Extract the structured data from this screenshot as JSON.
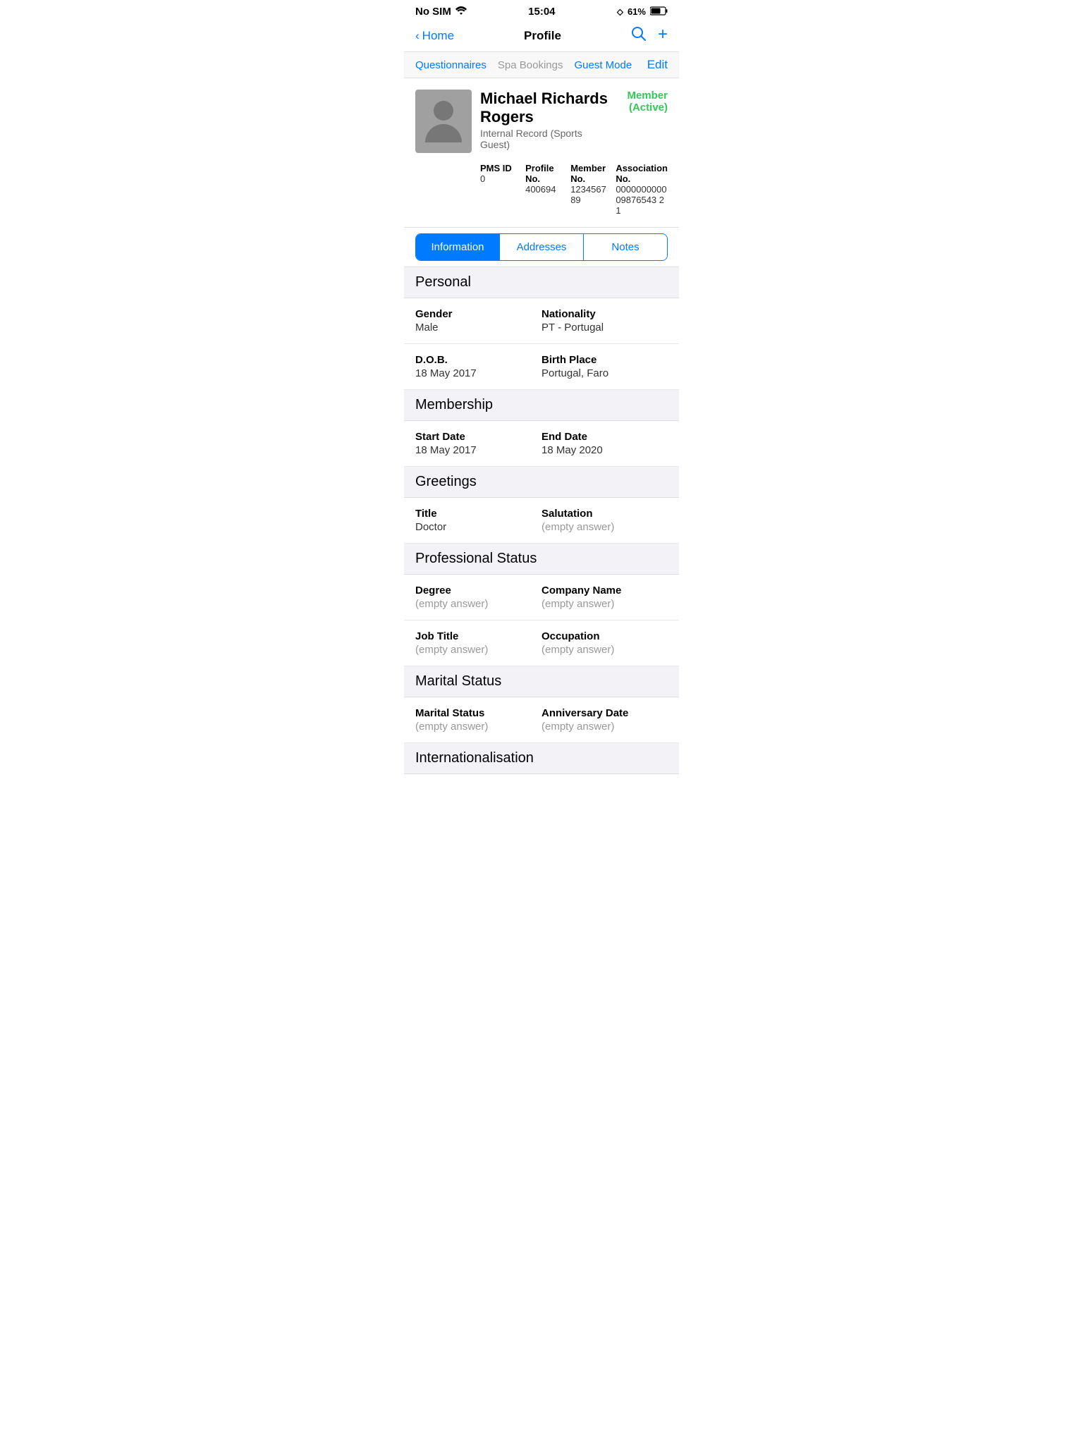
{
  "statusBar": {
    "carrier": "No SIM",
    "time": "15:04",
    "bluetooth": "B",
    "battery": "61%"
  },
  "navBar": {
    "backLabel": "Home",
    "title": "Profile",
    "searchIcon": "🔍",
    "addIcon": "+"
  },
  "subNav": {
    "items": [
      {
        "label": "Questionnaires",
        "active": true
      },
      {
        "label": "Spa Bookings",
        "active": false
      },
      {
        "label": "Guest Mode",
        "active": true
      }
    ],
    "editLabel": "Edit"
  },
  "profile": {
    "name": "Michael Richards Rogers",
    "subTitle": "Internal Record (Sports Guest)",
    "status": "Member (Active)",
    "pmsId": {
      "label": "PMS ID",
      "value": "0"
    },
    "profileNo": {
      "label": "Profile No.",
      "value": "400694"
    },
    "memberNo": {
      "label": "Member No.",
      "value": "123456789"
    },
    "associationNo": {
      "label": "Association No.",
      "value": "000000000009876543 21"
    }
  },
  "tabs": [
    {
      "label": "Information",
      "active": true
    },
    {
      "label": "Addresses",
      "active": false
    },
    {
      "label": "Notes",
      "active": false
    }
  ],
  "sections": [
    {
      "title": "Personal",
      "rows": [
        {
          "fields": [
            {
              "label": "Gender",
              "value": "Male",
              "empty": false
            },
            {
              "label": "Nationality",
              "value": "PT - Portugal",
              "empty": false
            }
          ]
        },
        {
          "fields": [
            {
              "label": "D.O.B.",
              "value": "18 May 2017",
              "empty": false
            },
            {
              "label": "Birth Place",
              "value": "Portugal, Faro",
              "empty": false
            }
          ]
        }
      ]
    },
    {
      "title": "Membership",
      "rows": [
        {
          "fields": [
            {
              "label": "Start Date",
              "value": "18 May 2017",
              "empty": false
            },
            {
              "label": "End Date",
              "value": "18 May 2020",
              "empty": false
            }
          ]
        }
      ]
    },
    {
      "title": "Greetings",
      "rows": [
        {
          "fields": [
            {
              "label": "Title",
              "value": "Doctor",
              "empty": false
            },
            {
              "label": "Salutation",
              "value": "(empty answer)",
              "empty": true
            }
          ]
        }
      ]
    },
    {
      "title": "Professional Status",
      "rows": [
        {
          "fields": [
            {
              "label": "Degree",
              "value": "(empty answer)",
              "empty": true
            },
            {
              "label": "Company Name",
              "value": "(empty answer)",
              "empty": true
            }
          ]
        },
        {
          "fields": [
            {
              "label": "Job Title",
              "value": "(empty answer)",
              "empty": true
            },
            {
              "label": "Occupation",
              "value": "(empty answer)",
              "empty": true
            }
          ]
        }
      ]
    },
    {
      "title": "Marital Status",
      "rows": [
        {
          "fields": [
            {
              "label": "Marital Status",
              "value": "(empty answer)",
              "empty": true
            },
            {
              "label": "Anniversary Date",
              "value": "(empty answer)",
              "empty": true
            }
          ]
        }
      ]
    },
    {
      "title": "Internationalisation",
      "rows": []
    }
  ]
}
